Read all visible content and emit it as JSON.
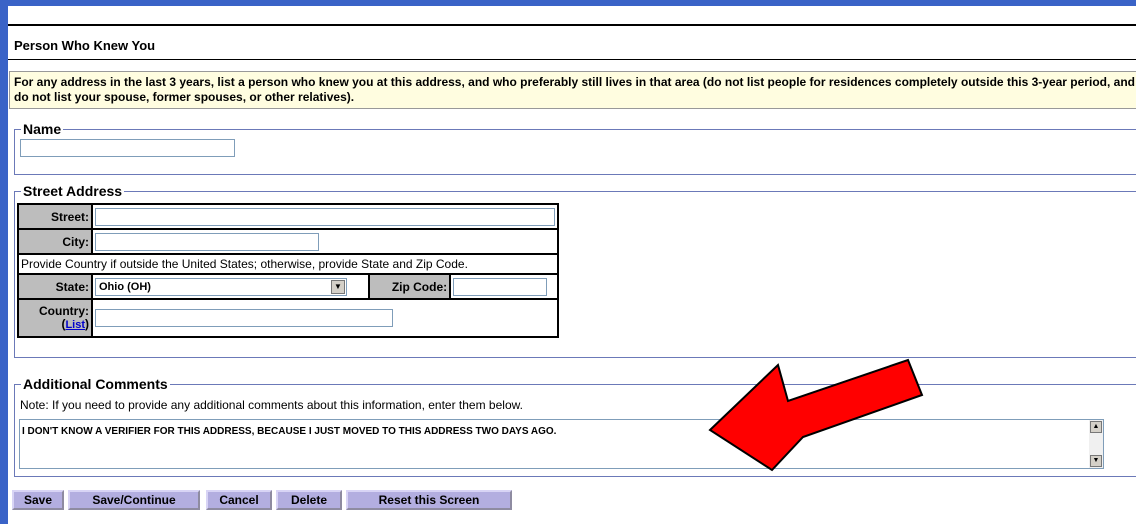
{
  "section": {
    "title": "Person Who Knew You",
    "instructions": "For any address in the last 3 years, list a person who knew you at this address, and who preferably still lives in that area (do not list people for residences completely outside this 3-year period, and do not list your spouse, former spouses, or other relatives)."
  },
  "name_group": {
    "legend": "Name",
    "value": ""
  },
  "address": {
    "legend": "Street Address",
    "street_label": "Street:",
    "street_value": "",
    "city_label": "City:",
    "city_value": "",
    "country_note": "Provide Country if outside the United States; otherwise, provide State and Zip Code.",
    "state_label": "State:",
    "state_value": "Ohio (OH)",
    "zip_label": "Zip Code:",
    "zip_value": "",
    "country_label": "Country:",
    "country_link": "List",
    "country_value": ""
  },
  "comments": {
    "legend": "Additional Comments",
    "note": "Note: If you need to provide any additional comments about this information, enter them below.",
    "text": "I DON'T KNOW A VERIFIER FOR THIS ADDRESS, BECAUSE I JUST MOVED TO THIS ADDRESS TWO DAYS AGO."
  },
  "buttons": {
    "save": "Save",
    "save_continue": "Save/Continue",
    "cancel": "Cancel",
    "delete": "Delete",
    "reset": "Reset this Screen"
  },
  "colors": {
    "frame": "#3a63c7",
    "instruction_bg": "#fffde0",
    "button_bg": "#b3aee0",
    "arrow": "#ff0000"
  },
  "icons": {
    "select_arrow": "chevron-down-icon",
    "scroll_up": "scroll-up-icon",
    "scroll_down": "scroll-down-icon",
    "annotation_arrow": "red-arrow-icon"
  }
}
